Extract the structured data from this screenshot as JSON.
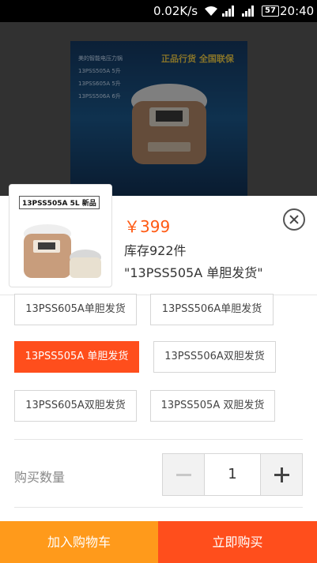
{
  "status_bar": {
    "network_speed": "0.02K/s",
    "battery_level": "57",
    "time": "20:40",
    "icons": [
      "wifi-icon",
      "signal-icon",
      "signal-icon",
      "battery-icon"
    ]
  },
  "product_image": {
    "promo_lines": [
      "美的智能电压力锅",
      "13PSS505A 5升",
      "13PSS605A 5升",
      "13PSS506A 6升"
    ],
    "slogan": "正品行货 全国联保"
  },
  "sku_panel": {
    "thumbnail_label": "13PSS505A 5L 新品",
    "price": "￥399",
    "stock": "库存922件",
    "selected": "\"13PSS505A 单胆发货\"",
    "close_icon": "close-circle-icon"
  },
  "options": [
    {
      "label": "13PSS605A单胆发货",
      "selected": false
    },
    {
      "label": "13PSS506A单胆发货",
      "selected": false
    },
    {
      "label": "13PSS505A 单胆发货",
      "selected": true
    },
    {
      "label": "13PSS506A双胆发货",
      "selected": false
    },
    {
      "label": "13PSS605A双胆发货",
      "selected": false
    },
    {
      "label": "13PSS505A 双胆发货",
      "selected": false
    }
  ],
  "quantity": {
    "label": "购买数量",
    "value": "1",
    "minus_icon": "minus-icon",
    "plus_icon": "plus-icon"
  },
  "actions": {
    "add_to_cart": "加入购物车",
    "buy_now": "立即购买"
  },
  "colors": {
    "accent": "#ff4e1c",
    "cart_button": "#ff9a1b",
    "price": "#ff5a13"
  }
}
